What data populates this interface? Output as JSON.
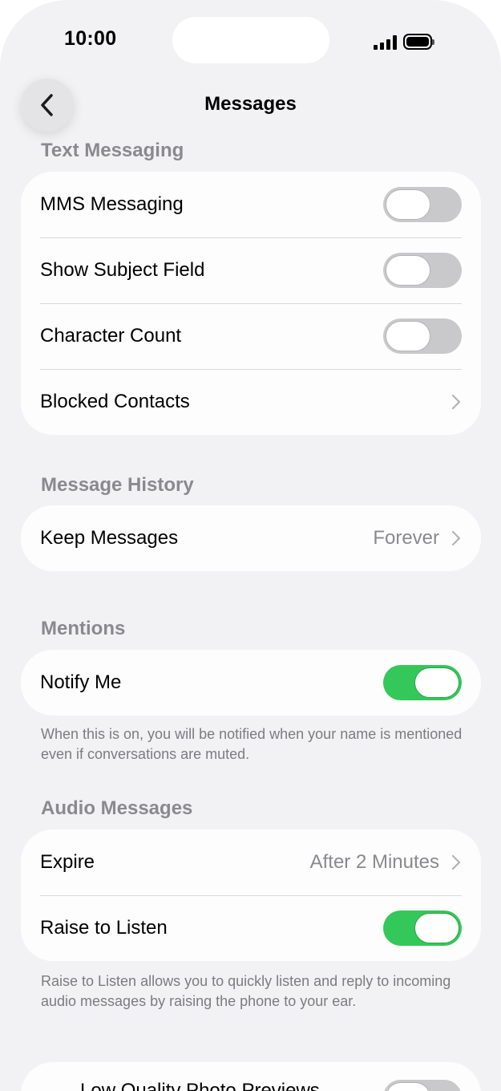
{
  "status_bar": {
    "time": "10:00"
  },
  "nav": {
    "title": "Messages"
  },
  "sections": {
    "text_messaging": {
      "header": "Text Messaging",
      "rows": [
        {
          "label": "MMS Messaging",
          "toggle": "off"
        },
        {
          "label": "Show Subject Field",
          "toggle": "off"
        },
        {
          "label": "Character Count",
          "toggle": "off"
        },
        {
          "label": "Blocked Contacts"
        }
      ]
    },
    "message_history": {
      "header": "Message History",
      "rows": [
        {
          "label": "Keep Messages",
          "value": "Forever"
        }
      ]
    },
    "mentions": {
      "header": "Mentions",
      "rows": [
        {
          "label": "Notify Me",
          "toggle": "on"
        }
      ],
      "footer": "When this is on, you will be notified when your name is mentioned even if conversations are muted."
    },
    "audio_messages": {
      "header": "Audio Messages",
      "rows": [
        {
          "label": "Expire",
          "value": "After 2 Minutes"
        },
        {
          "label": "Raise to Listen",
          "toggle": "on"
        }
      ],
      "footer": "Raise to Listen allows you to quickly listen and reply to incoming audio messages by raising the phone to your ear."
    },
    "partial": {
      "rows": [
        {
          "label": "Low Quality Photo Previews",
          "toggle": "off"
        }
      ]
    }
  },
  "colors": {
    "toggle_on": "#34c759",
    "toggle_off": "#c9c9cb",
    "secondary_text": "#8a8a8e"
  }
}
